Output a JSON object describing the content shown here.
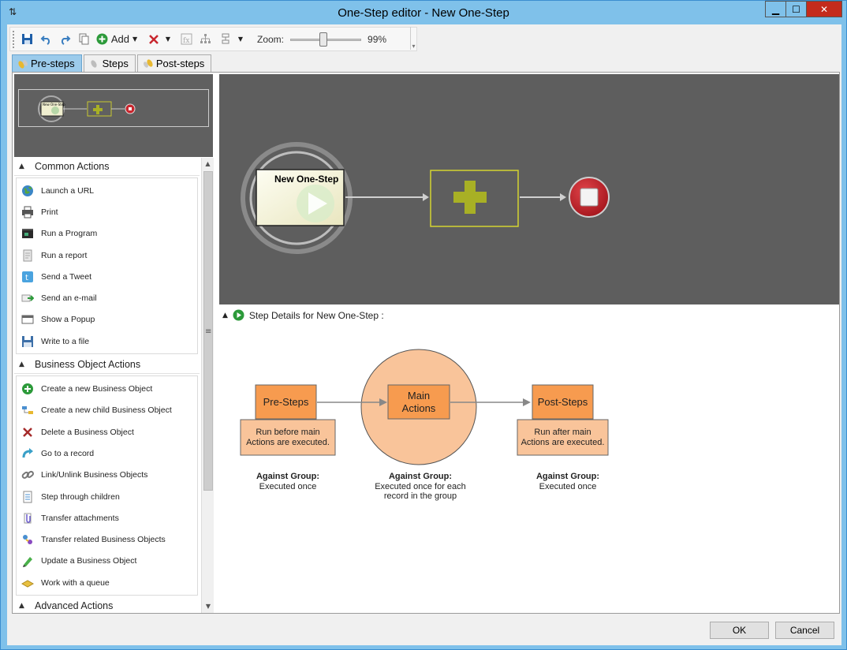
{
  "window": {
    "title": "One-Step editor - New One-Step",
    "minimize": "▁",
    "maximize": "☐",
    "close": "✕"
  },
  "toolbar": {
    "add_label": "Add",
    "zoom_label": "Zoom:",
    "zoom_value": "99%",
    "zoom_level_percent": 99
  },
  "tabs": [
    {
      "label": "Pre-steps",
      "active": true
    },
    {
      "label": "Steps",
      "active": false
    },
    {
      "label": "Post-steps",
      "active": false
    }
  ],
  "minimap": {
    "label": "New One-Step"
  },
  "palette": {
    "sections": [
      {
        "title": "Common Actions",
        "items": [
          "Launch a URL",
          "Print",
          "Run a Program",
          "Run a report",
          "Send a Tweet",
          "Send an e-mail",
          "Show a Popup",
          "Write to a file"
        ]
      },
      {
        "title": "Business Object Actions",
        "items": [
          "Create a new Business Object",
          "Create a new child Business Object",
          "Delete a Business Object",
          "Go to a record",
          "Link/Unlink Business Objects",
          "Step through children",
          "Transfer attachments",
          "Transfer related Business Objects",
          "Update a Business Object",
          "Work with a queue"
        ]
      },
      {
        "title": "Advanced Actions",
        "items": []
      }
    ]
  },
  "canvas": {
    "start_label": "New One-Step"
  },
  "details": {
    "header": "Step Details for New One-Step :",
    "pre": {
      "box": "Pre-Steps",
      "desc1": "Run before main",
      "desc2": "Actions are executed.",
      "group_title": "Against Group:",
      "group1": "Executed once"
    },
    "main": {
      "box1": "Main",
      "box2": "Actions",
      "group_title": "Against Group:",
      "group1": "Executed once for each",
      "group2": "record in the group"
    },
    "post": {
      "box": "Post-Steps",
      "desc1": "Run after main",
      "desc2": "Actions are executed.",
      "group_title": "Against Group:",
      "group1": "Executed once"
    }
  },
  "buttons": {
    "ok": "OK",
    "cancel": "Cancel"
  },
  "colors": {
    "titlebar": "#7fc1ea",
    "canvas": "#5e5e5e",
    "orange": "#f79b4f",
    "peach": "#f9c49a",
    "olive": "#a8b025",
    "stop_red": "#c8262e"
  }
}
